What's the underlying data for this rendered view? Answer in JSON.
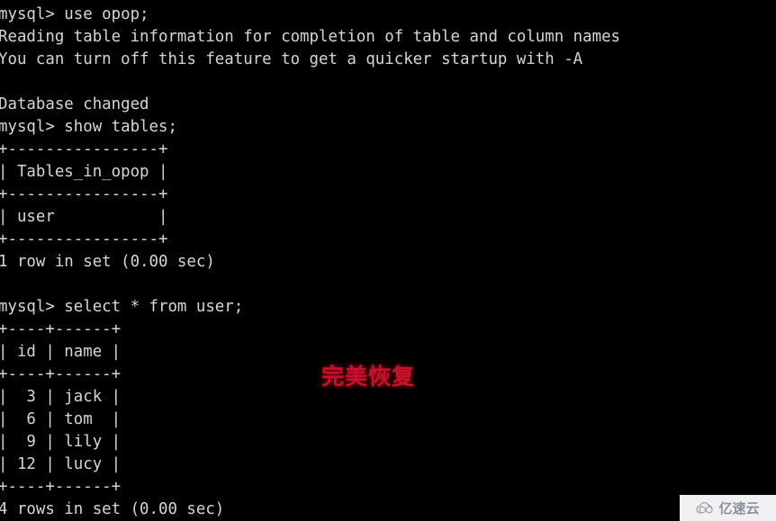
{
  "terminal": {
    "background_color": "#000000",
    "text_color": "#d6d6d6",
    "prompt": "mysql>",
    "lines": [
      "mysql> use opop;",
      "Reading table information for completion of table and column names",
      "You can turn off this feature to get a quicker startup with -A",
      "",
      "Database changed",
      "mysql> show tables;",
      "+----------------+",
      "| Tables_in_opop |",
      "+----------------+",
      "| user           |",
      "+----------------+",
      "1 row in set (0.00 sec)",
      "",
      "mysql> select * from user;",
      "+----+------+",
      "| id | name |",
      "+----+------+",
      "|  3 | jack |",
      "|  6 | tom  |",
      "|  9 | lily |",
      "| 12 | lucy |",
      "+----+------+",
      "4 rows in set (0.00 sec)"
    ],
    "commands": [
      "use opop;",
      "show tables;",
      "select * from user;"
    ],
    "results": {
      "show_tables": {
        "type": "table",
        "columns": [
          "Tables_in_opop"
        ],
        "rows": [
          [
            "user"
          ]
        ],
        "footer": "1 row in set (0.00 sec)"
      },
      "select_user": {
        "type": "table",
        "columns": [
          "id",
          "name"
        ],
        "rows": [
          [
            "3",
            "jack"
          ],
          [
            "6",
            "tom"
          ],
          [
            "9",
            "lily"
          ],
          [
            "12",
            "lucy"
          ]
        ],
        "footer": "4 rows in set (0.00 sec)"
      },
      "use_database": {
        "notice_1": "Reading table information for completion of table and column names",
        "notice_2": "You can turn off this feature to get a quicker startup with -A",
        "status": "Database changed"
      }
    }
  },
  "annotation": {
    "text": "完美恢复",
    "color": "#c8102a"
  },
  "watermark": {
    "text": "亿速云",
    "icon": "cloud-icon",
    "background_color": "#f1f1f3",
    "text_color": "#8a909c"
  }
}
